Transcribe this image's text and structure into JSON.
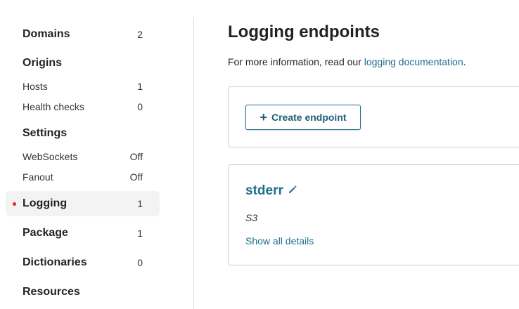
{
  "sidebar": {
    "items": [
      {
        "label": "Domains",
        "count": "2"
      },
      {
        "label": "Hosts",
        "count": "1"
      },
      {
        "label": "Health checks",
        "count": "0"
      },
      {
        "label": "WebSockets",
        "count": "Off"
      },
      {
        "label": "Fanout",
        "count": "Off"
      },
      {
        "label": "Logging",
        "count": "1"
      },
      {
        "label": "Package",
        "count": "1"
      },
      {
        "label": "Dictionaries",
        "count": "0"
      }
    ],
    "headings": {
      "origins": "Origins",
      "settings": "Settings",
      "resources": "Resources"
    }
  },
  "main": {
    "title": "Logging endpoints",
    "intro_prefix": "For more information, read our ",
    "intro_link": "logging documentation",
    "intro_suffix": ".",
    "create_button": "Create endpoint",
    "endpoint": {
      "name": "stderr",
      "type": "S3",
      "details_link": "Show all details"
    }
  },
  "colors": {
    "accent": "#1f6f8b",
    "active_dot": "#e4272d"
  }
}
